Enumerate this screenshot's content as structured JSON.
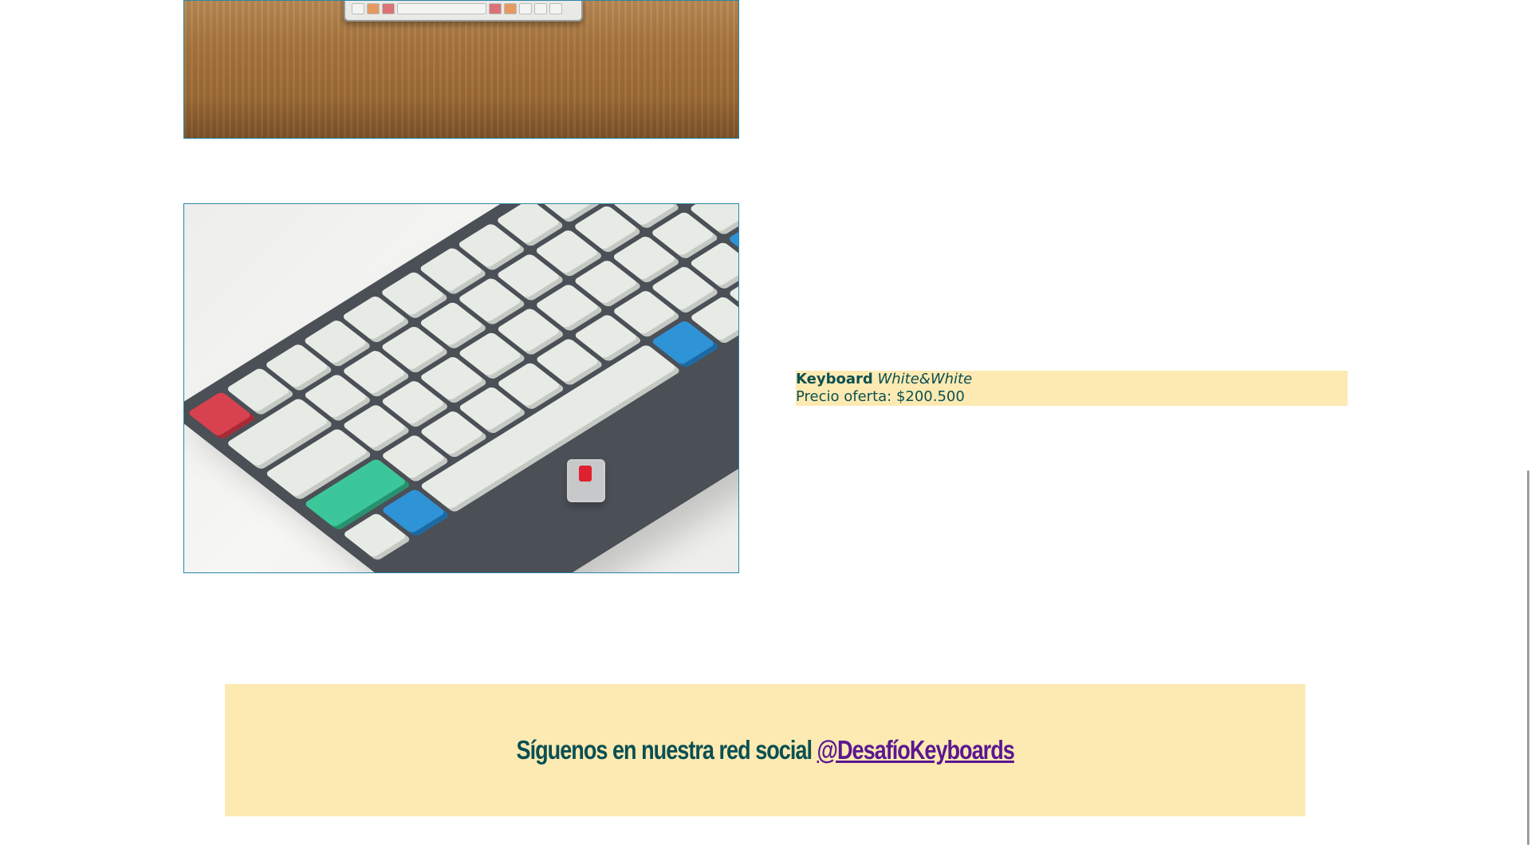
{
  "products": [
    {
      "image_alt": "Teclado sobre escritorio de madera"
    },
    {
      "image_alt": "Teclado White&White con switch rojo",
      "name": "Keyboard",
      "model": "White&White",
      "price_label": "Precio oferta: $200.500"
    }
  ],
  "footer": {
    "text": "Síguenos en nuestra red social ",
    "handle": "@DesafíoKeyboards"
  },
  "colors": {
    "highlight_bg": "#fdeab2",
    "text_teal": "#0b4f52",
    "link_purple": "#5b1790",
    "image_border": "#2a86a8"
  }
}
